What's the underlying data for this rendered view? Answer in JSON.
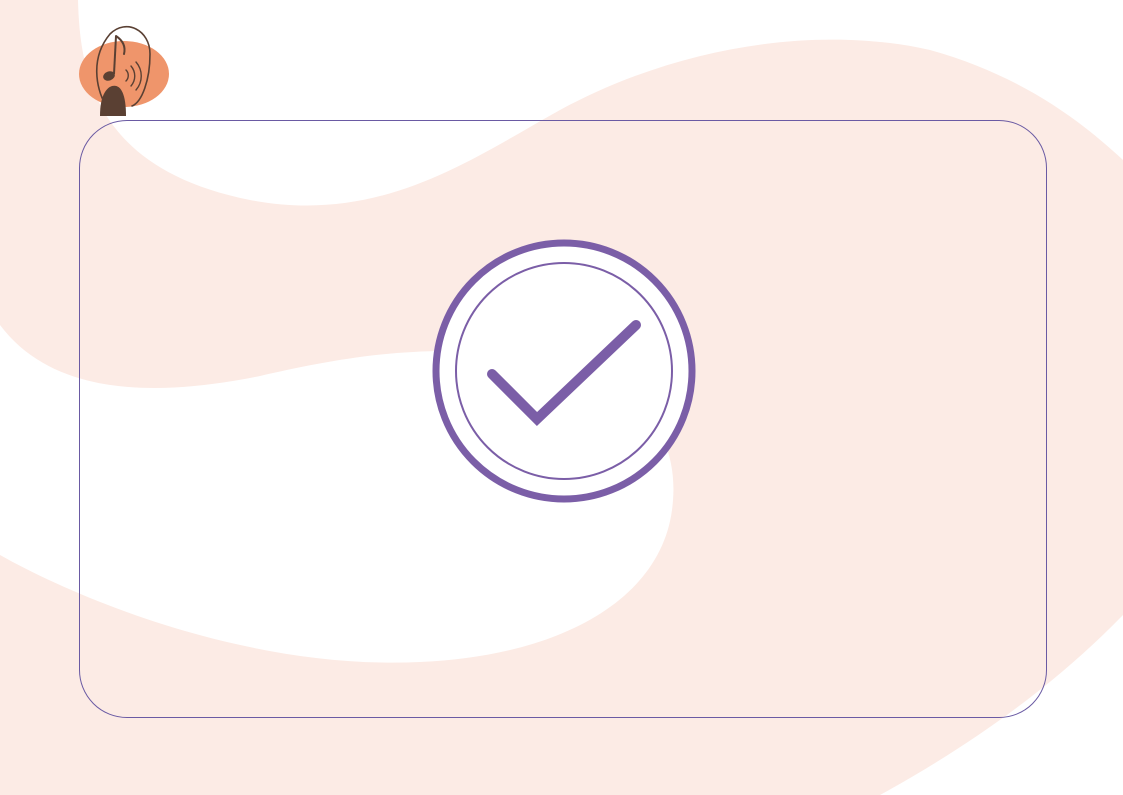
{
  "colors": {
    "background": "#ffffff",
    "blob": "#fcebe5",
    "accent": "#7b5ea7",
    "card_border": "#6a5aa3",
    "logo_orange": "#ef956b",
    "logo_brown": "#5a4033"
  },
  "icons": {
    "logo": "music-note-head-icon",
    "status": "check-circle-icon"
  }
}
